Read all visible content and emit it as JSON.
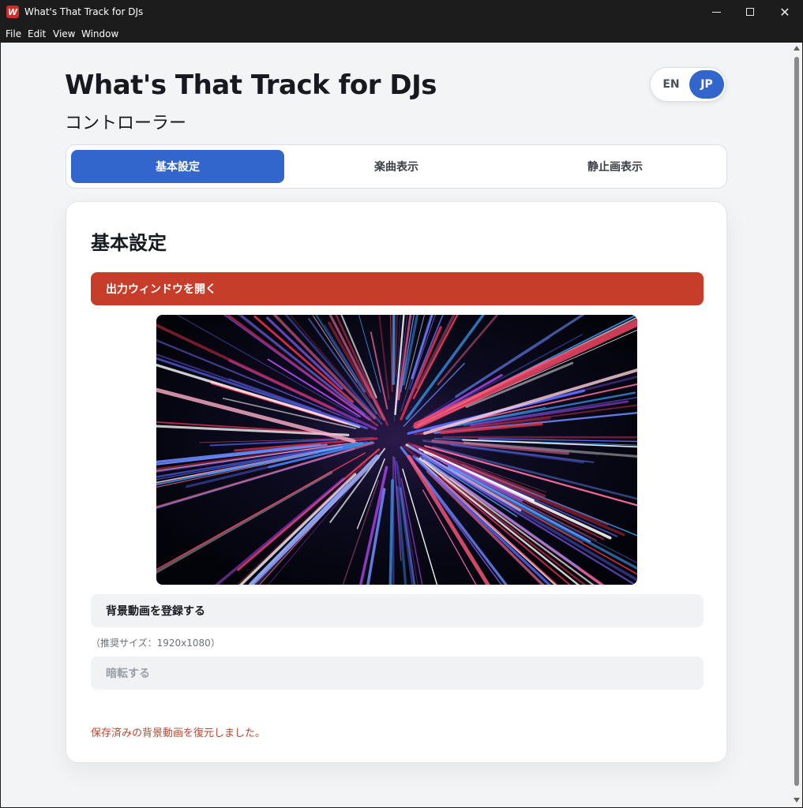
{
  "window": {
    "title": "What's That Track for DJs",
    "icon_letter": "W",
    "controls": {
      "minimize": "—",
      "maximize": "☐",
      "close": "✕"
    }
  },
  "menu": [
    "File",
    "Edit",
    "View",
    "Window"
  ],
  "header": {
    "title": "What's That Track for DJs",
    "subtitle": "コントローラー"
  },
  "language": {
    "options": [
      "EN",
      "JP"
    ],
    "selected": "JP",
    "accent_color": "#3366cc"
  },
  "tabs": [
    {
      "label": "基本設定",
      "active": true
    },
    {
      "label": "楽曲表示",
      "active": false
    },
    {
      "label": "静止画表示",
      "active": false
    }
  ],
  "panel": {
    "title": "基本設定",
    "open_output_button": "出力ウィンドウを開く",
    "open_output_color": "#c63d2a",
    "register_video_button": "背景動画を登録する",
    "recommended_size": "（推奨サイズ：1920x1080）",
    "blackout_button": "暗転する",
    "status_message": "保存済みの背景動画を復元しました。"
  }
}
